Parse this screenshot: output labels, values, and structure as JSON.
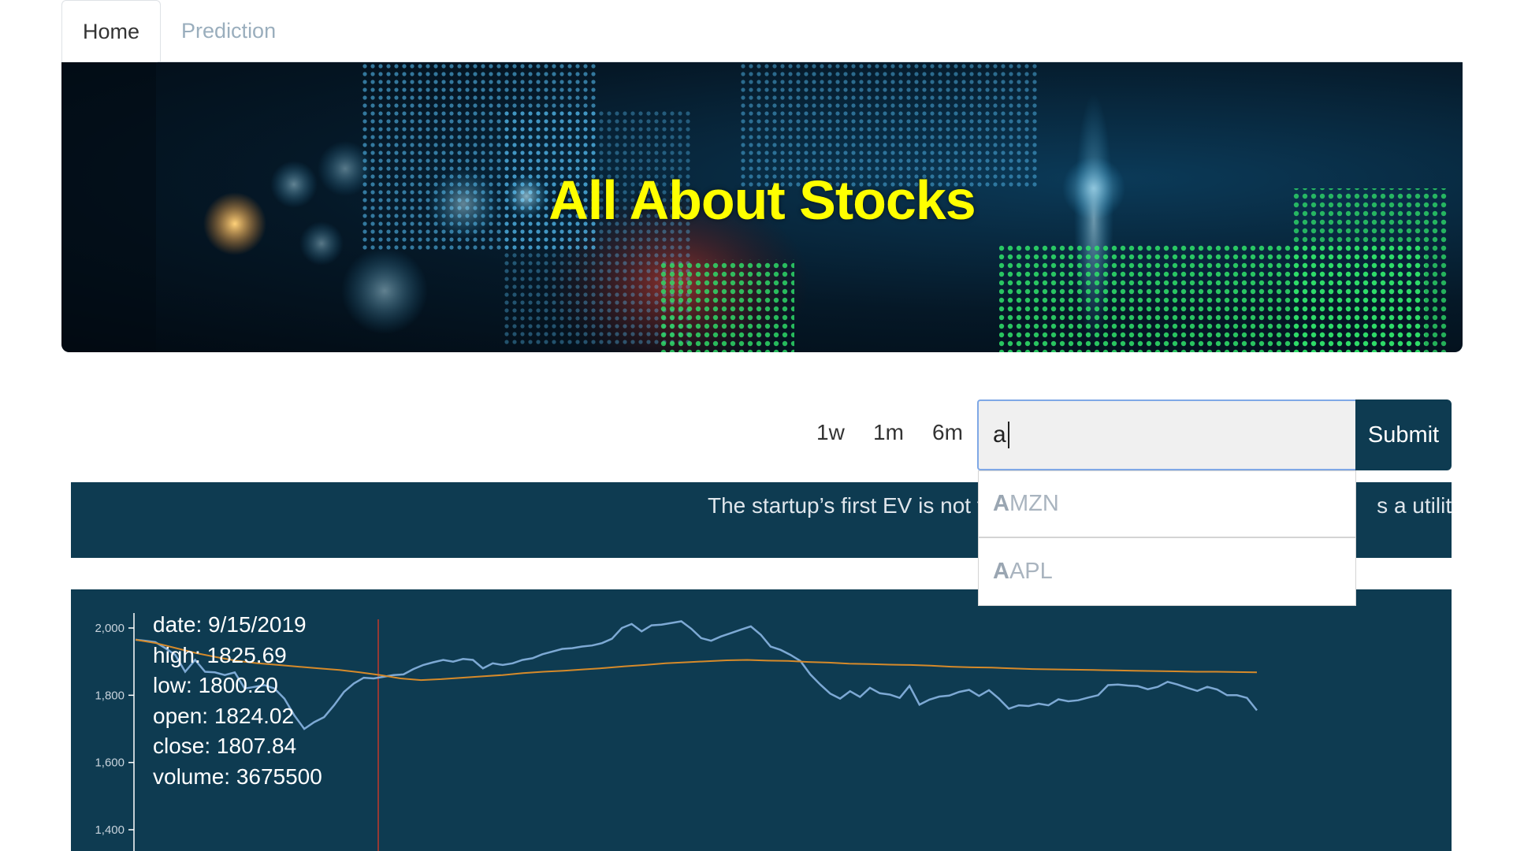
{
  "tabs": [
    {
      "label": "Home",
      "active": true
    },
    {
      "label": "Prediction",
      "active": false
    }
  ],
  "hero": {
    "title": "All About Stocks",
    "title_color": "#ffff00"
  },
  "controls": {
    "ranges": [
      "1w",
      "1m",
      "6m"
    ],
    "search_value": "a",
    "submit_label": "Submit"
  },
  "autocomplete": [
    {
      "match": "A",
      "rest": "MZN"
    },
    {
      "match": "A",
      "rest": "APL"
    }
  ],
  "news": {
    "left_text": "The startup’s first EV is not tryi",
    "right_text": "s a utilitari"
  },
  "chart_data": {
    "type": "line",
    "y_ticks": [
      "2,000",
      "1,800",
      "1,600",
      "1,400"
    ],
    "ylim": [
      1400,
      2000
    ],
    "series": [
      {
        "values": [
          1965,
          1962,
          1958,
          1940,
          1920,
          1870,
          1905,
          1870,
          1868,
          1860,
          1868,
          1820,
          1825,
          1830,
          1820,
          1790,
          1740,
          1700,
          1720,
          1735,
          1770,
          1810,
          1835,
          1852,
          1850,
          1855,
          1860,
          1862,
          1878,
          1890,
          1898,
          1905,
          1900,
          1908,
          1905,
          1880,
          1895,
          1890,
          1895,
          1905,
          1910,
          1922,
          1930,
          1938,
          1940,
          1945,
          1948,
          1955,
          1968,
          2000,
          2012,
          1990,
          2008,
          2010,
          2015,
          2020,
          1998,
          1970,
          1962,
          1975,
          1985,
          1995,
          2005,
          1980,
          1945,
          1935,
          1920,
          1902,
          1862,
          1832,
          1805,
          1790,
          1812,
          1795,
          1822,
          1806,
          1802,
          1792,
          1828,
          1772,
          1787,
          1796,
          1799,
          1810,
          1816,
          1798,
          1815,
          1790,
          1760,
          1770,
          1768,
          1775,
          1770,
          1788,
          1782,
          1785,
          1793,
          1800,
          1830,
          1832,
          1829,
          1827,
          1818,
          1825,
          1840,
          1832,
          1822,
          1813,
          1825,
          1817,
          1800,
          1800,
          1792,
          1755
        ],
        "color": "#7da9d4"
      },
      {
        "values": [
          1965,
          1955,
          1940,
          1925,
          1913,
          1902,
          1895,
          1890,
          1885,
          1880,
          1875,
          1868,
          1860,
          1850,
          1845,
          1848,
          1852,
          1856,
          1860,
          1866,
          1870,
          1873,
          1877,
          1881,
          1886,
          1890,
          1895,
          1898,
          1901,
          1904,
          1905,
          1903,
          1902,
          1899,
          1897,
          1894,
          1893,
          1891,
          1890,
          1888,
          1885,
          1883,
          1882,
          1880,
          1878,
          1877,
          1876,
          1875,
          1874,
          1873,
          1872,
          1871,
          1870,
          1870,
          1869,
          1868
        ],
        "color": "#d68a2a"
      }
    ],
    "tooltip": {
      "date": "date: 9/15/2019",
      "high": "high: 1825.69",
      "low": "low: 1800.20",
      "open": "open: 1824.02",
      "close": "close: 1807.84",
      "volume": "volume: 3675500"
    }
  }
}
